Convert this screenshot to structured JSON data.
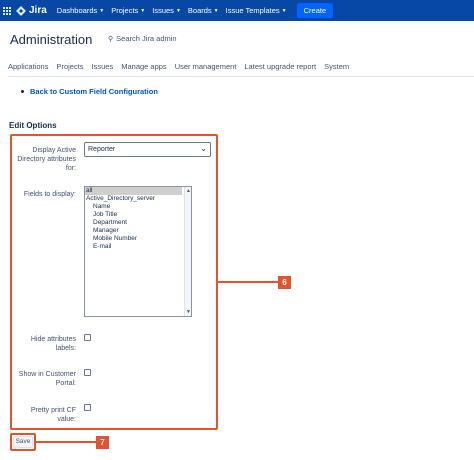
{
  "topnav": {
    "logo_text": "Jira",
    "items": [
      "Dashboards",
      "Projects",
      "Issues",
      "Boards",
      "Issue Templates"
    ],
    "create_label": "Create",
    "colors": {
      "nav_bg": "#0747a6",
      "create_bg": "#0065ff"
    }
  },
  "header": {
    "title": "Administration",
    "search_placeholder": "Search Jira admin"
  },
  "tabs": [
    "Applications",
    "Projects",
    "Issues",
    "Manage apps",
    "User management",
    "Latest upgrade report",
    "System"
  ],
  "back_link": "Back to Custom Field Configuration",
  "edit_options": {
    "section_title": "Edit Options",
    "display_label_1": "Display Active",
    "display_label_2": "Directory attributes",
    "display_label_3": "for:",
    "display_value": "Reporter",
    "fields_label": "Fields to display:",
    "fields_options": [
      "all",
      "Active_Directory_server",
      "Name",
      "Job Title",
      "Department",
      "Manager",
      "Mobile Number",
      "E-mail"
    ],
    "hide_label_1": "Hide attributes",
    "hide_label_2": "labels:",
    "portal_label_1": "Show in Customer",
    "portal_label_2": "Portal:",
    "pretty_label_1": "Pretty print CF",
    "pretty_label_2": "value:"
  },
  "save_label": "Save",
  "callouts": {
    "form": "6",
    "save": "7",
    "color": "#e5532e"
  }
}
